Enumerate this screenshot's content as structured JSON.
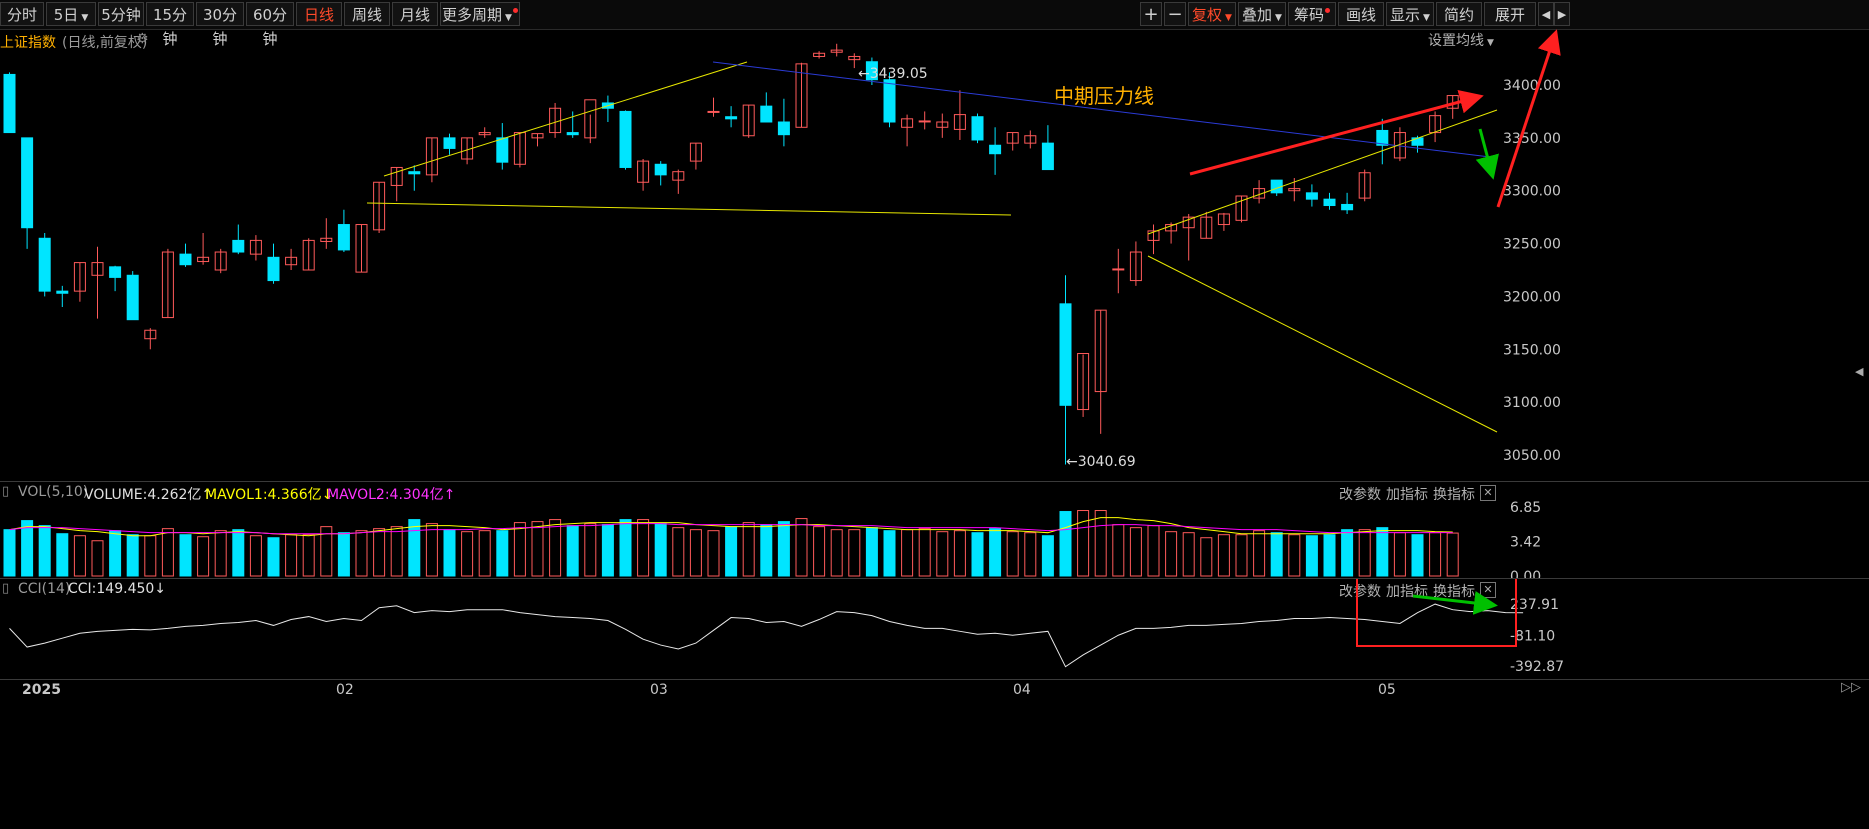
{
  "toolbar": {
    "left": [
      "分时",
      "5日",
      "5分钟",
      "15分钟",
      "30分钟",
      "60分钟",
      "日线",
      "周线",
      "月线",
      "更多周期"
    ],
    "active": "日线",
    "right": [
      "+",
      "−",
      "复权",
      "叠加",
      "筹码",
      "画线",
      "显示",
      "简约",
      "展开"
    ]
  },
  "main": {
    "index_name": "上证指数",
    "mode": "(日线,前复权)",
    "ma_setting": "设置均线",
    "high_label": "3439.05",
    "low_label": "3040.69",
    "annotation": "中期压力线",
    "price_ticks": [
      "3400.00",
      "3350.00",
      "3300.00",
      "3250.00",
      "3200.00",
      "3150.00",
      "3100.00",
      "3050.00"
    ]
  },
  "vol": {
    "name": "VOL(5,10)",
    "volume": "VOLUME:4.262亿",
    "mavol1": "MAVOL1:4.366亿",
    "mavol2": "MAVOL2:4.304亿",
    "ticks": [
      "6.85",
      "3.42",
      "0.00"
    ]
  },
  "cci": {
    "name": "CCI(14)",
    "value": "CCI:149.450",
    "ticks": [
      "237.91",
      "-81.10",
      "-392.87"
    ]
  },
  "panel_buttons": [
    "改参数",
    "加指标",
    "换指标"
  ],
  "x_labels": [
    "2025",
    "02",
    "03",
    "04",
    "05"
  ],
  "colors": {
    "up": "#ff5a5a",
    "down": "#00e5ff",
    "ma5": "#ffff00",
    "ma10": "#ff00ff",
    "accent": "#ff4a2a",
    "annotation": "#ffb000"
  },
  "chart_data": {
    "type": "candlestick",
    "title": "上证指数",
    "ylim": [
      3020,
      3460
    ],
    "candles": [
      {
        "o": 3410,
        "h": 3412,
        "l": 3355,
        "c": 3355
      },
      {
        "o": 3350,
        "h": 3350,
        "l": 3245,
        "c": 3265
      },
      {
        "o": 3255,
        "h": 3260,
        "l": 3200,
        "c": 3205
      },
      {
        "o": 3205,
        "h": 3210,
        "l": 3190,
        "c": 3203
      },
      {
        "o": 3205,
        "h": 3232,
        "l": 3195,
        "c": 3232
      },
      {
        "o": 3220,
        "h": 3247,
        "l": 3179,
        "c": 3232
      },
      {
        "o": 3228,
        "h": 3229,
        "l": 3205,
        "c": 3218
      },
      {
        "o": 3220,
        "h": 3224,
        "l": 3178,
        "c": 3178
      },
      {
        "o": 3160,
        "h": 3170,
        "l": 3150,
        "c": 3168
      },
      {
        "o": 3180,
        "h": 3245,
        "l": 3180,
        "c": 3242
      },
      {
        "o": 3240,
        "h": 3250,
        "l": 3228,
        "c": 3230
      },
      {
        "o": 3233,
        "h": 3260,
        "l": 3230,
        "c": 3237
      },
      {
        "o": 3225,
        "h": 3245,
        "l": 3222,
        "c": 3242
      },
      {
        "o": 3253,
        "h": 3268,
        "l": 3240,
        "c": 3242
      },
      {
        "o": 3240,
        "h": 3258,
        "l": 3234,
        "c": 3253
      },
      {
        "o": 3237,
        "h": 3250,
        "l": 3212,
        "c": 3215
      },
      {
        "o": 3230,
        "h": 3245,
        "l": 3225,
        "c": 3237
      },
      {
        "o": 3225,
        "h": 3255,
        "l": 3225,
        "c": 3253
      },
      {
        "o": 3252,
        "h": 3274,
        "l": 3245,
        "c": 3255
      },
      {
        "o": 3268,
        "h": 3282,
        "l": 3242,
        "c": 3244
      },
      {
        "o": 3223,
        "h": 3268,
        "l": 3223,
        "c": 3268
      },
      {
        "o": 3263,
        "h": 3308,
        "l": 3260,
        "c": 3308
      },
      {
        "o": 3305,
        "h": 3322,
        "l": 3290,
        "c": 3322
      },
      {
        "o": 3318,
        "h": 3324,
        "l": 3300,
        "c": 3316
      },
      {
        "o": 3315,
        "h": 3350,
        "l": 3308,
        "c": 3350
      },
      {
        "o": 3350,
        "h": 3354,
        "l": 3334,
        "c": 3340
      },
      {
        "o": 3330,
        "h": 3350,
        "l": 3325,
        "c": 3350
      },
      {
        "o": 3353,
        "h": 3360,
        "l": 3350,
        "c": 3355
      },
      {
        "o": 3350,
        "h": 3364,
        "l": 3320,
        "c": 3327
      },
      {
        "o": 3325,
        "h": 3355,
        "l": 3322,
        "c": 3355
      },
      {
        "o": 3350,
        "h": 3354,
        "l": 3342,
        "c": 3354
      },
      {
        "o": 3355,
        "h": 3383,
        "l": 3350,
        "c": 3378
      },
      {
        "o": 3355,
        "h": 3375,
        "l": 3350,
        "c": 3353
      },
      {
        "o": 3350,
        "h": 3372,
        "l": 3345,
        "c": 3386
      },
      {
        "o": 3383,
        "h": 3390,
        "l": 3365,
        "c": 3378
      },
      {
        "o": 3375,
        "h": 3376,
        "l": 3320,
        "c": 3322
      },
      {
        "o": 3308,
        "h": 3330,
        "l": 3300,
        "c": 3328
      },
      {
        "o": 3325,
        "h": 3328,
        "l": 3305,
        "c": 3315
      },
      {
        "o": 3310,
        "h": 3320,
        "l": 3297,
        "c": 3318
      },
      {
        "o": 3328,
        "h": 3345,
        "l": 3320,
        "c": 3345
      },
      {
        "o": 3375,
        "h": 3388,
        "l": 3370,
        "c": 3375
      },
      {
        "o": 3370,
        "h": 3380,
        "l": 3360,
        "c": 3368
      },
      {
        "o": 3352,
        "h": 3381,
        "l": 3350,
        "c": 3381
      },
      {
        "o": 3380,
        "h": 3393,
        "l": 3372,
        "c": 3365
      },
      {
        "o": 3365,
        "h": 3387,
        "l": 3342,
        "c": 3353
      },
      {
        "o": 3360,
        "h": 3421,
        "l": 3360,
        "c": 3420
      },
      {
        "o": 3427,
        "h": 3432,
        "l": 3425,
        "c": 3430
      },
      {
        "o": 3431,
        "h": 3439,
        "l": 3427,
        "c": 3433
      },
      {
        "o": 3424,
        "h": 3430,
        "l": 3416,
        "c": 3427
      },
      {
        "o": 3422,
        "h": 3426,
        "l": 3400,
        "c": 3405
      },
      {
        "o": 3405,
        "h": 3412,
        "l": 3360,
        "c": 3365
      },
      {
        "o": 3360,
        "h": 3372,
        "l": 3342,
        "c": 3368
      },
      {
        "o": 3366,
        "h": 3375,
        "l": 3358,
        "c": 3366
      },
      {
        "o": 3360,
        "h": 3373,
        "l": 3350,
        "c": 3365
      },
      {
        "o": 3358,
        "h": 3395,
        "l": 3348,
        "c": 3372
      },
      {
        "o": 3370,
        "h": 3373,
        "l": 3345,
        "c": 3348
      },
      {
        "o": 3343,
        "h": 3360,
        "l": 3315,
        "c": 3335
      },
      {
        "o": 3345,
        "h": 3355,
        "l": 3338,
        "c": 3355
      },
      {
        "o": 3345,
        "h": 3357,
        "l": 3340,
        "c": 3352
      },
      {
        "o": 3345,
        "h": 3362,
        "l": 3320,
        "c": 3320
      },
      {
        "o": 3193,
        "h": 3220,
        "l": 3041,
        "c": 3097
      },
      {
        "o": 3093,
        "h": 3145,
        "l": 3086,
        "c": 3146
      },
      {
        "o": 3110,
        "h": 3187,
        "l": 3070,
        "c": 3187
      },
      {
        "o": 3226,
        "h": 3245,
        "l": 3203,
        "c": 3226
      },
      {
        "o": 3215,
        "h": 3252,
        "l": 3210,
        "c": 3242
      },
      {
        "o": 3253,
        "h": 3268,
        "l": 3240,
        "c": 3262
      },
      {
        "o": 3262,
        "h": 3270,
        "l": 3250,
        "c": 3268
      },
      {
        "o": 3265,
        "h": 3278,
        "l": 3234,
        "c": 3275
      },
      {
        "o": 3255,
        "h": 3280,
        "l": 3255,
        "c": 3275
      },
      {
        "o": 3268,
        "h": 3279,
        "l": 3262,
        "c": 3278
      },
      {
        "o": 3272,
        "h": 3295,
        "l": 3270,
        "c": 3295
      },
      {
        "o": 3293,
        "h": 3310,
        "l": 3288,
        "c": 3302
      },
      {
        "o": 3310,
        "h": 3308,
        "l": 3295,
        "c": 3298
      },
      {
        "o": 3300,
        "h": 3312,
        "l": 3290,
        "c": 3302
      },
      {
        "o": 3298,
        "h": 3306,
        "l": 3285,
        "c": 3292
      },
      {
        "o": 3292,
        "h": 3298,
        "l": 3282,
        "c": 3286
      },
      {
        "o": 3287,
        "h": 3298,
        "l": 3278,
        "c": 3282
      },
      {
        "o": 3293,
        "h": 3320,
        "l": 3290,
        "c": 3317
      },
      {
        "o": 3357,
        "h": 3368,
        "l": 3325,
        "c": 3343
      },
      {
        "o": 3331,
        "h": 3360,
        "l": 3328,
        "c": 3355
      },
      {
        "o": 3350,
        "h": 3352,
        "l": 3336,
        "c": 3343
      },
      {
        "o": 3355,
        "h": 3375,
        "l": 3346,
        "c": 3371
      },
      {
        "o": 3378,
        "h": 3390,
        "l": 3368,
        "c": 3390
      }
    ],
    "volume_ylim": [
      0,
      6.85
    ],
    "volume": [
      4.6,
      5.5,
      5.0,
      4.2,
      4.0,
      3.5,
      4.5,
      4.1,
      4.0,
      4.7,
      4.1,
      3.9,
      4.5,
      4.6,
      4.0,
      3.8,
      4.1,
      4.1,
      4.9,
      4.3,
      4.5,
      4.7,
      4.9,
      5.6,
      5.2,
      4.6,
      4.4,
      4.5,
      4.5,
      5.3,
      5.4,
      5.6,
      5.0,
      5.2,
      5.1,
      5.6,
      5.6,
      5.2,
      4.8,
      4.6,
      4.5,
      4.9,
      5.3,
      5.1,
      5.4,
      5.7,
      4.9,
      4.6,
      4.6,
      4.8,
      4.5,
      4.6,
      4.7,
      4.4,
      4.5,
      4.3,
      4.7,
      4.4,
      4.3,
      4.0,
      6.4,
      6.5,
      6.5,
      5.1,
      4.8,
      5.0,
      4.4,
      4.3,
      3.8,
      4.1,
      4.1,
      4.5,
      4.3,
      4.1,
      4.0,
      4.1,
      4.6,
      4.6,
      4.8,
      4.3,
      4.1,
      4.3,
      4.262
    ],
    "mavol1": [
      4.6,
      4.9,
      4.9,
      4.7,
      4.5,
      4.4,
      4.2,
      4.0,
      4.0,
      4.3,
      4.3,
      4.2,
      4.3,
      4.4,
      4.3,
      4.2,
      4.1,
      4.0,
      4.2,
      4.2,
      4.3,
      4.5,
      4.7,
      4.9,
      5.0,
      5.0,
      4.9,
      4.8,
      4.6,
      4.7,
      4.9,
      5.1,
      5.2,
      5.3,
      5.3,
      5.3,
      5.3,
      5.3,
      5.3,
      5.1,
      5.0,
      4.9,
      4.9,
      4.9,
      5.0,
      5.1,
      5.1,
      5.0,
      4.9,
      4.8,
      4.7,
      4.6,
      4.6,
      4.6,
      4.6,
      4.5,
      4.5,
      4.5,
      4.4,
      4.3,
      4.8,
      5.4,
      5.8,
      5.8,
      5.6,
      5.5,
      5.2,
      4.8,
      4.6,
      4.4,
      4.2,
      4.2,
      4.2,
      4.2,
      4.2,
      4.2,
      4.3,
      4.4,
      4.5,
      4.5,
      4.5,
      4.4,
      4.366
    ],
    "mavol2": [
      4.6,
      4.8,
      4.8,
      4.8,
      4.7,
      4.6,
      4.5,
      4.4,
      4.3,
      4.3,
      4.3,
      4.3,
      4.3,
      4.3,
      4.3,
      4.2,
      4.2,
      4.2,
      4.2,
      4.2,
      4.3,
      4.4,
      4.4,
      4.5,
      4.6,
      4.6,
      4.6,
      4.7,
      4.7,
      4.8,
      4.8,
      4.9,
      5.0,
      5.0,
      5.1,
      5.2,
      5.2,
      5.2,
      5.1,
      5.1,
      5.1,
      5.1,
      5.1,
      5.1,
      5.1,
      5.1,
      5.0,
      5.0,
      5.0,
      5.0,
      4.9,
      4.8,
      4.8,
      4.8,
      4.8,
      4.8,
      4.8,
      4.7,
      4.6,
      4.5,
      4.6,
      4.8,
      5.0,
      5.1,
      5.1,
      5.0,
      5.0,
      4.9,
      4.8,
      4.7,
      4.6,
      4.6,
      4.6,
      4.5,
      4.4,
      4.3,
      4.3,
      4.3,
      4.3,
      4.3,
      4.3,
      4.3,
      4.304
    ],
    "cci_ylim": [
      -392.87,
      280
    ],
    "cci": [
      -10,
      -200,
      -160,
      -110,
      -60,
      -40,
      -30,
      -20,
      -25,
      -10,
      10,
      20,
      40,
      50,
      70,
      20,
      80,
      110,
      60,
      90,
      70,
      200,
      220,
      150,
      170,
      160,
      180,
      180,
      180,
      150,
      130,
      110,
      100,
      90,
      70,
      -20,
      -120,
      -180,
      -220,
      -160,
      -30,
      100,
      90,
      50,
      60,
      10,
      80,
      160,
      150,
      120,
      60,
      20,
      -10,
      -10,
      -40,
      -70,
      -60,
      -80,
      -60,
      -40,
      -400,
      -280,
      -180,
      -80,
      -10,
      -10,
      0,
      20,
      20,
      30,
      40,
      60,
      70,
      90,
      90,
      100,
      90,
      80,
      60,
      40,
      150,
      237,
      180,
      160,
      170,
      150,
      149.45
    ]
  }
}
